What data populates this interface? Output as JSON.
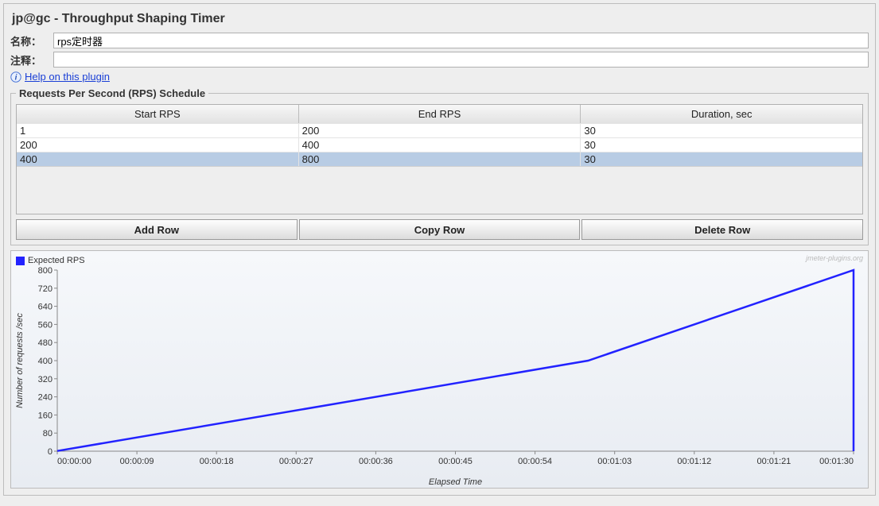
{
  "title": "jp@gc - Throughput Shaping Timer",
  "name_label": "名称：",
  "name_value": "rps定时器",
  "comment_label": "注释：",
  "comment_value": "",
  "help_link": "Help on this plugin",
  "fieldset_title": "Requests Per Second (RPS) Schedule",
  "columns": {
    "start": "Start RPS",
    "end": "End RPS",
    "duration": "Duration, sec"
  },
  "rows": [
    {
      "start": "1",
      "end": "200",
      "duration": "30"
    },
    {
      "start": "200",
      "end": "400",
      "duration": "30"
    },
    {
      "start": "400",
      "end": "800",
      "duration": "30"
    }
  ],
  "buttons": {
    "add": "Add Row",
    "copy": "Copy Row",
    "delete": "Delete Row"
  },
  "chart_legend": "Expected RPS",
  "watermark": "jmeter-plugins.org",
  "chart_ylabel": "Number of requests /sec",
  "chart_xlabel": "Elapsed Time",
  "chart_data": {
    "type": "line",
    "title": "",
    "xlabel": "Elapsed Time",
    "ylabel": "Number of requests /sec",
    "ylim": [
      0,
      800
    ],
    "xlim_sec": [
      0,
      90
    ],
    "y_ticks": [
      0,
      80,
      160,
      240,
      320,
      400,
      480,
      560,
      640,
      720,
      800
    ],
    "x_ticks_sec": [
      0,
      9,
      18,
      27,
      36,
      45,
      54,
      63,
      72,
      81,
      90
    ],
    "x_tick_labels": [
      "00:00:00",
      "00:00:09",
      "00:00:18",
      "00:00:27",
      "00:00:36",
      "00:00:45",
      "00:00:54",
      "00:01:03",
      "00:01:12",
      "00:01:21",
      "00:01:30"
    ],
    "series": [
      {
        "name": "Expected RPS",
        "color": "#2222ff",
        "points": [
          {
            "t_sec": 0,
            "rps": 1
          },
          {
            "t_sec": 30,
            "rps": 200
          },
          {
            "t_sec": 30,
            "rps": 200
          },
          {
            "t_sec": 60,
            "rps": 400
          },
          {
            "t_sec": 60,
            "rps": 400
          },
          {
            "t_sec": 90,
            "rps": 800
          },
          {
            "t_sec": 90,
            "rps": 0
          }
        ]
      }
    ]
  }
}
